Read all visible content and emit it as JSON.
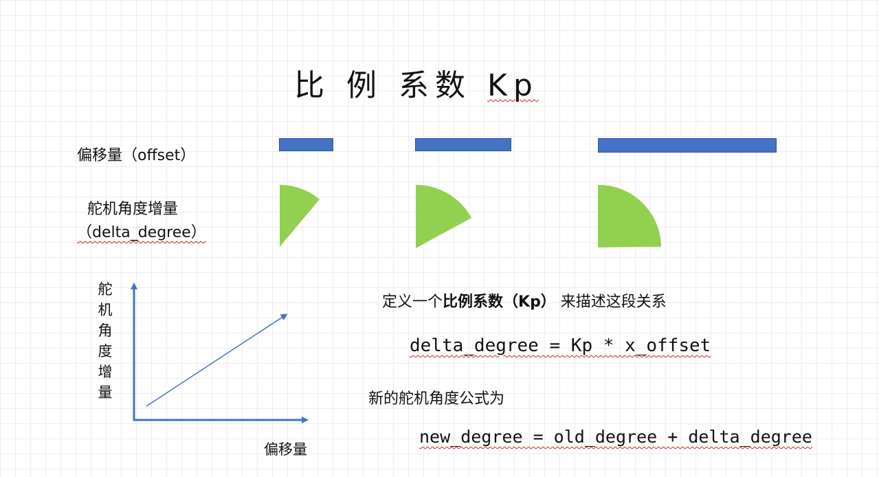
{
  "title": {
    "main": "比 例 系数 ",
    "kp": "Kp"
  },
  "labels": {
    "offset": "偏移量（offset）",
    "servo_line1": "舵机角度增量",
    "servo_line2": "（delta_degree）"
  },
  "graph": {
    "y_label": [
      "舵",
      "机",
      "角",
      "度",
      "增",
      "量"
    ],
    "x_label": "偏移量"
  },
  "text": {
    "define_prefix": "定义一个",
    "define_bold": "比例系数（Kp）",
    "define_suffix": " 来描述这段关系",
    "formula1": "delta_degree = Kp * x_offset",
    "new_formula_label": "新的舵机角度公式为",
    "formula2": "new_degree = old_degree + delta_degree"
  },
  "colors": {
    "bar": "#4472c4",
    "sector": "#92d050",
    "axis": "#4472c4"
  }
}
